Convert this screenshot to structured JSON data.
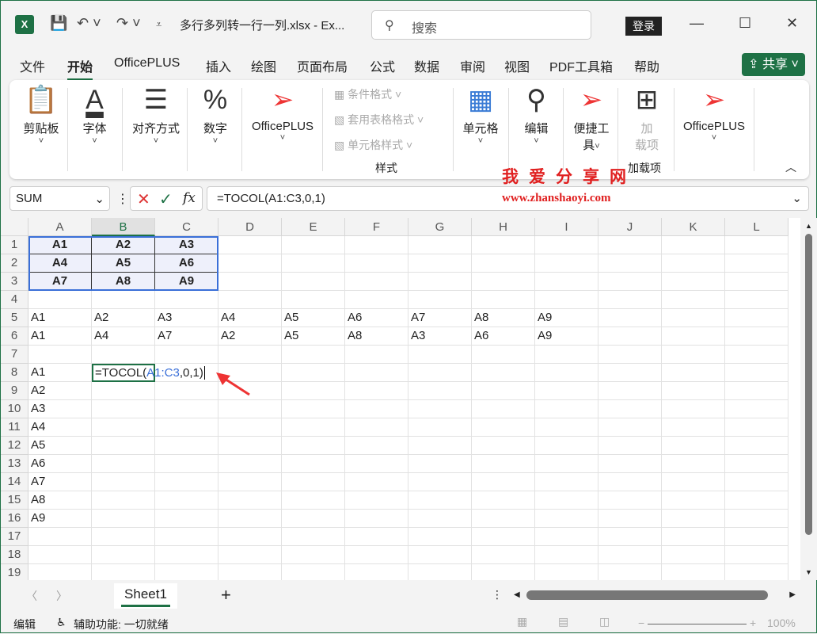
{
  "title": {
    "app_icon": "X",
    "document": "多行多列转一行一列.xlsx  -  Ex...",
    "search_placeholder": "搜索",
    "login": "登录"
  },
  "menu": {
    "tabs": [
      "文件",
      "开始",
      "OfficePLUS",
      "插入",
      "绘图",
      "页面布局",
      "公式",
      "数据",
      "审阅",
      "视图",
      "PDF工具箱",
      "帮助"
    ],
    "active": 1,
    "share": "共享"
  },
  "ribbon": {
    "clipboard": "剪贴板",
    "font": "字体",
    "align": "对齐方式",
    "number": "数字",
    "officeplus": "OfficePLUS",
    "cond_format": "条件格式",
    "table_format": "套用表格格式",
    "cell_style": "单元格样式",
    "styles_group": "样式",
    "cells": "单元格",
    "edit": "编辑",
    "quick_tools_1": "便捷工",
    "quick_tools_2": "具",
    "addins_1": "加",
    "addins_2": "载项",
    "addins_group": "加载项",
    "officeplus2": "OfficePLUS"
  },
  "watermark": {
    "line1": "我爱分享网",
    "line2": "www.zhanshaoyi.com"
  },
  "formula_bar": {
    "name_box": "SUM",
    "formula": "=TOCOL(A1:C3,0,1)"
  },
  "columns": [
    "A",
    "B",
    "C",
    "D",
    "E",
    "F",
    "G",
    "H",
    "I",
    "J",
    "K",
    "L"
  ],
  "selected_column": "B",
  "rows": 19,
  "cells": {
    "A1": "A1",
    "B1": "A2",
    "C1": "A3",
    "A2": "A4",
    "B2": "A5",
    "C2": "A6",
    "A3": "A7",
    "B3": "A8",
    "C3": "A9",
    "A5": "A1",
    "B5": "A2",
    "C5": "A3",
    "D5": "A4",
    "E5": "A5",
    "F5": "A6",
    "G5": "A7",
    "H5": "A8",
    "I5": "A9",
    "A6": "A1",
    "B6": "A4",
    "C6": "A7",
    "D6": "A2",
    "E6": "A5",
    "F6": "A8",
    "G6": "A3",
    "H6": "A6",
    "I6": "A9",
    "A8": "A1",
    "A9": "A2",
    "A10": "A3",
    "A11": "A4",
    "A12": "A5",
    "A13": "A6",
    "A14": "A7",
    "A15": "A8",
    "A16": "A9"
  },
  "editing_cell": {
    "ref": "B8",
    "prefix": "=TOCOL(",
    "range": "A1:C3",
    "suffix": ",0,1)"
  },
  "sheets": [
    "Sheet1"
  ],
  "status": {
    "mode": "编辑",
    "accessibility": "辅助功能: 一切就绪",
    "zoom": "100%"
  }
}
